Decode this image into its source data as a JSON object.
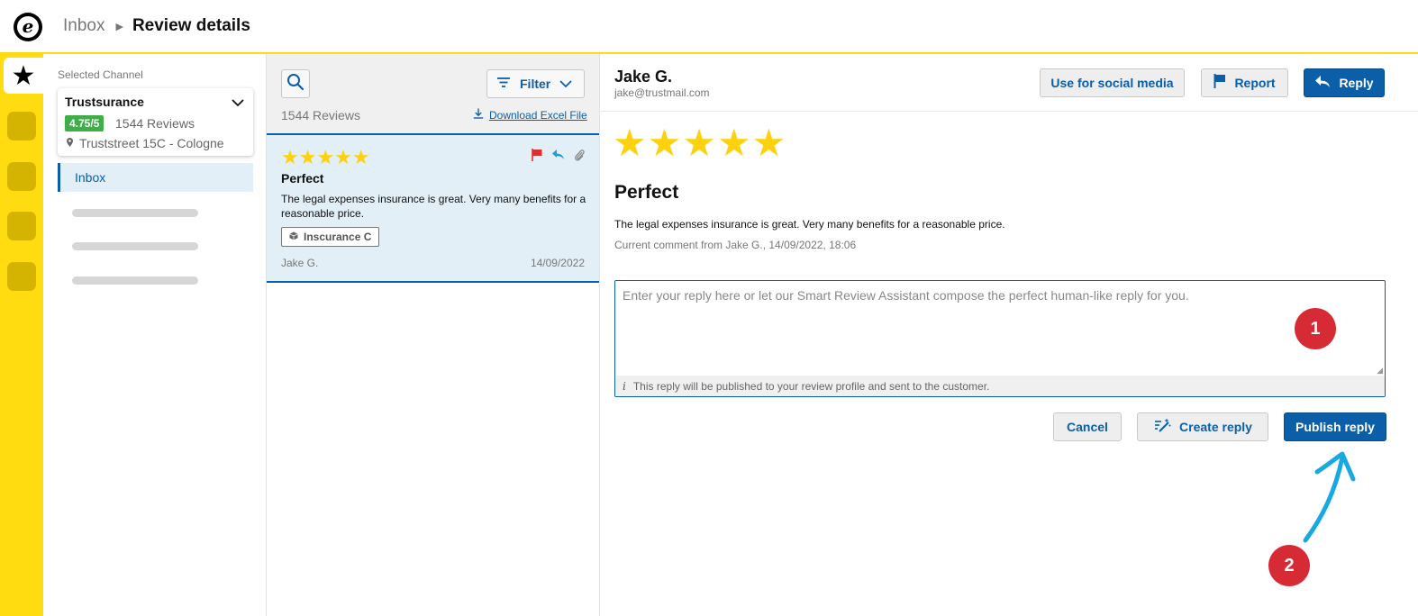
{
  "header": {
    "logo_letter": "e",
    "breadcrumb_inbox": "Inbox",
    "breadcrumb_current": "Review details"
  },
  "rail": {
    "active_icon": "star-icon"
  },
  "sidebar": {
    "selected_channel_label": "Selected Channel",
    "channel": {
      "name": "Trustsurance",
      "rating": "4.75/5",
      "review_count": "1544 Reviews",
      "address": "Truststreet 15C - Cologne"
    },
    "nav": {
      "inbox_label": "Inbox"
    }
  },
  "list": {
    "review_count": "1544 Reviews",
    "filter_label": "Filter",
    "download_label": "Download Excel File",
    "items": [
      {
        "stars": "★★★★★",
        "title": "Perfect",
        "text": "The legal expenses insurance is great. Very many benefits for a reasonable price.",
        "tag": "Inscurance C",
        "author": "Jake G.",
        "date": "14/09/2022"
      }
    ]
  },
  "detail": {
    "author_name": "Jake G.",
    "author_email": "jake@trustmail.com",
    "buttons": {
      "social": "Use for social media",
      "report": "Report",
      "reply": "Reply"
    },
    "stars": "★★★★★",
    "rating_value": 5,
    "title": "Perfect",
    "text": "The legal expenses insurance is great. Very many benefits for a reasonable price.",
    "meta": "Current comment from Jake G., 14/09/2022, 18:06",
    "reply": {
      "placeholder": "Enter your reply here or let our Smart Review Assistant compose the perfect human-like reply for you.",
      "value": "",
      "note": "This reply will be published to your review profile and sent to the customer."
    },
    "actions": {
      "cancel": "Cancel",
      "create": "Create reply",
      "publish": "Publish reply"
    }
  },
  "annotations": {
    "marker_1": "1",
    "marker_2": "2",
    "marker_color": "#d62b35",
    "arrow_color": "#1aa8e0"
  },
  "colors": {
    "brand_yellow": "#ffdc0f",
    "primary_blue": "#0b5ea8",
    "star_yellow": "#fcd10e",
    "rating_green": "#3fae49"
  }
}
